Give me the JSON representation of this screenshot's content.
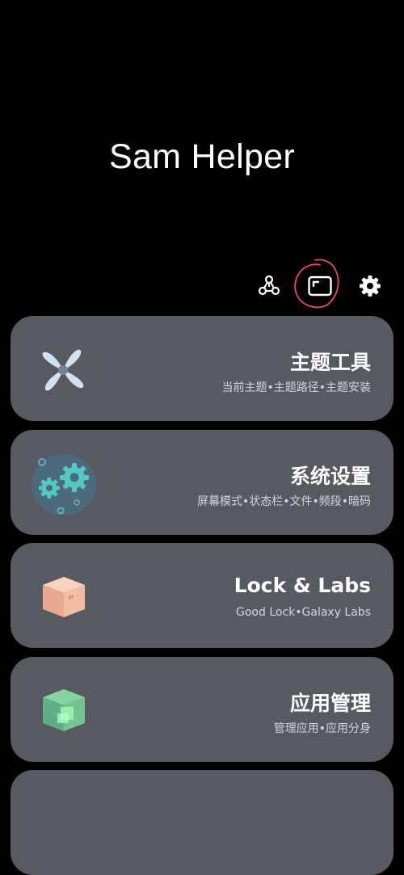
{
  "app": {
    "title": "Sam Helper"
  },
  "toolbar": {
    "buttons": [
      {
        "icon": "network-nodes-icon"
      },
      {
        "icon": "window-icon"
      },
      {
        "icon": "gear-icon"
      }
    ],
    "annotation_color": "#e8456b"
  },
  "cards": [
    {
      "title": "主题工具",
      "subtitle": "当前主题•主题路径•主题安装",
      "icon": "pinwheel-icon"
    },
    {
      "title": "系统设置",
      "subtitle": "屏幕模式•状态栏•文件•频段•暗码",
      "icon": "gears-icon"
    },
    {
      "title": "Lock & Labs",
      "subtitle": "Good Lock•Galaxy Labs",
      "icon": "box-icon"
    },
    {
      "title": "应用管理",
      "subtitle": "管理应用•应用分身",
      "icon": "cube-icon"
    }
  ],
  "colors": {
    "background": "#000000",
    "card": "#585a61",
    "text": "#ffffff",
    "subtext": "#d4d6da"
  }
}
